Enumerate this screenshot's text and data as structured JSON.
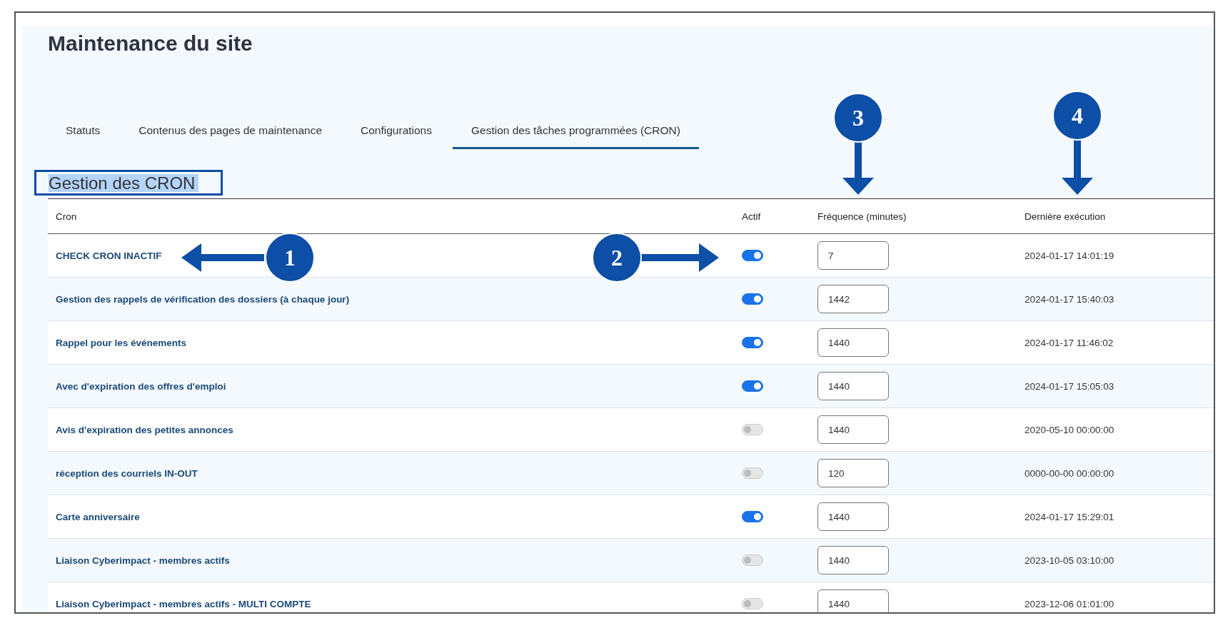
{
  "page": {
    "title": "Maintenance du site"
  },
  "tabs": [
    {
      "label": "Statuts",
      "selected": false
    },
    {
      "label": "Contenus des pages de maintenance",
      "selected": false
    },
    {
      "label": "Configurations",
      "selected": false
    },
    {
      "label": "Gestion des tâches programmées (CRON)",
      "selected": true
    }
  ],
  "section": {
    "title": "Gestion des CRON",
    "highlighted": true
  },
  "table": {
    "columns": [
      "Cron",
      "Actif",
      "Fréquence (minutes)",
      "Dernière exécution"
    ],
    "rows": [
      {
        "name": "CHECK CRON INACTIF",
        "active": true,
        "frequency": "7",
        "last_run": "2024-01-17 14:01:19"
      },
      {
        "name": "Gestion des rappels de vérification des dossiers (à chaque jour)",
        "active": true,
        "frequency": "1442",
        "last_run": "2024-01-17 15:40:03"
      },
      {
        "name": "Rappel pour les événements",
        "active": true,
        "frequency": "1440",
        "last_run": "2024-01-17 11:46:02"
      },
      {
        "name": "Avec d'expiration des offres d'emploi",
        "active": true,
        "frequency": "1440",
        "last_run": "2024-01-17 15:05:03"
      },
      {
        "name": "Avis d'expiration des petites annonces",
        "active": false,
        "frequency": "1440",
        "last_run": "2020-05-10 00:00:00"
      },
      {
        "name": "réception des courriels IN-OUT",
        "active": false,
        "frequency": "120",
        "last_run": "0000-00-00 00:00:00"
      },
      {
        "name": "Carte anniversaire",
        "active": true,
        "frequency": "1440",
        "last_run": "2024-01-17 15:29:01"
      },
      {
        "name": "Liaison Cyberimpact - membres actifs",
        "active": false,
        "frequency": "1440",
        "last_run": "2023-10-05 03:10:00"
      },
      {
        "name": "Liaison Cyberimpact - membres actifs - MULTI COMPTE",
        "active": false,
        "frequency": "1440",
        "last_run": "2023-12-06 01:01:00"
      }
    ]
  },
  "annotations": [
    {
      "label": "1"
    },
    {
      "label": "2"
    },
    {
      "label": "3"
    },
    {
      "label": "4"
    }
  ]
}
